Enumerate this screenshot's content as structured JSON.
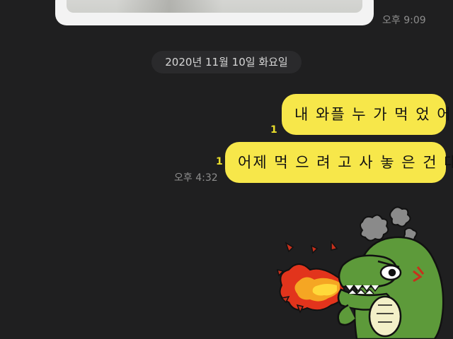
{
  "chat": {
    "photo_time": "오후 9:09",
    "date_divider": "2020년 11월 10일 화요일",
    "messages": [
      {
        "text": "내 와플 누 가 먹 었 어",
        "read_count": "1"
      },
      {
        "text": "어제 먹 으 려 고 사 놓 은 건 대",
        "read_count": "1",
        "time": "오후 4:32"
      }
    ],
    "sticker": "angry-green-dinosaur-breathing-fire-sticker"
  },
  "colors": {
    "background": "#1f1f20",
    "bubble": "#f7e74a",
    "read_count": "#e9dd2b",
    "timestamp": "#8d8d8d"
  }
}
